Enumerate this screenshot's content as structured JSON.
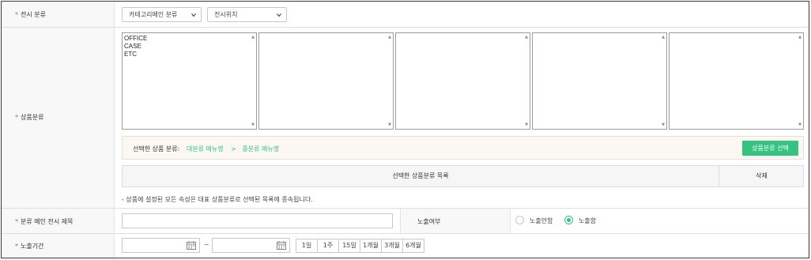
{
  "display_category": {
    "label": "전시 분류",
    "select1": "카테고리메인 분류",
    "select2": "전시위치"
  },
  "product_category": {
    "label": "상품분류",
    "listboxes": [
      {
        "items": [
          "OFFICE",
          "CASE",
          "ETC"
        ]
      },
      {
        "items": []
      },
      {
        "items": []
      },
      {
        "items": []
      },
      {
        "items": []
      }
    ],
    "selected_label": "선택한 상품 분류:",
    "major_placeholder": "대분류 메뉴명",
    "separator": ">",
    "middle_placeholder": "중분류 메뉴명",
    "select_button": "상품분류 선택",
    "table_header_list": "선택한 상품분류 목록",
    "table_header_delete": "삭제",
    "note": "- 상품에 설정된 모든 속성은 대표 상품분류로 선택된 목록에 종속됩니다."
  },
  "main_title": {
    "label": "분류 메인 전시 제목",
    "value": ""
  },
  "exposure": {
    "label": "노출여부",
    "options": [
      "노출안함",
      "노출함"
    ],
    "selected": "노출함"
  },
  "period": {
    "label": "노출기간",
    "start": "",
    "tilde": "~",
    "end": "",
    "quick": [
      "1일",
      "1주",
      "15일",
      "1개월",
      "3개월",
      "6개월"
    ]
  },
  "colors": {
    "accent": "#34c480",
    "required": "#e05050"
  }
}
